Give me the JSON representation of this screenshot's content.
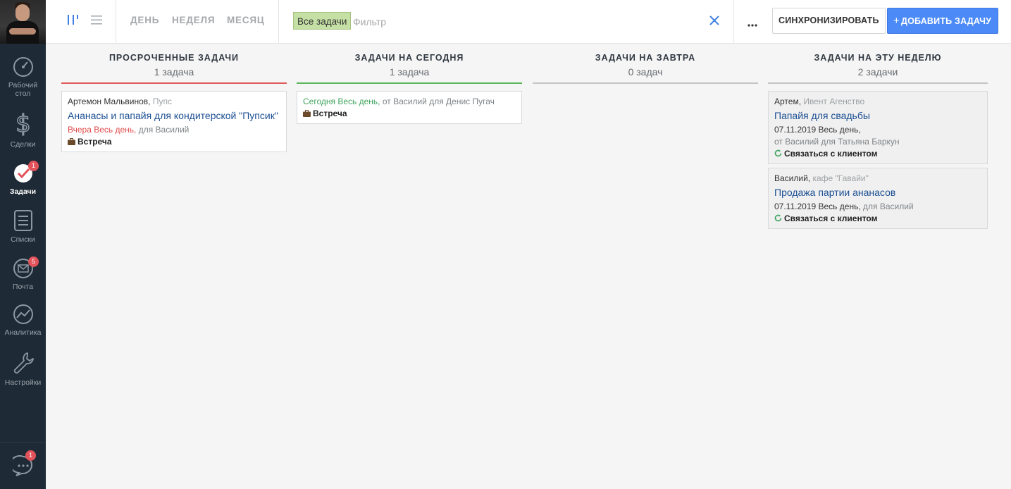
{
  "sidebar": {
    "items": [
      {
        "label": "Рабочий стол"
      },
      {
        "label": "Сделки"
      },
      {
        "label": "Задачи",
        "badge": "1"
      },
      {
        "label": "Списки"
      },
      {
        "label": "Почта",
        "badge": "5"
      },
      {
        "label": "Аналитика"
      },
      {
        "label": "Настройки"
      }
    ],
    "chat_badge": "1"
  },
  "topbar": {
    "periods": [
      "ДЕНЬ",
      "НЕДЕЛЯ",
      "МЕСЯЦ"
    ],
    "filter_chip": "Все задачи",
    "filter_placeholder": "Фильтр",
    "sync_label": "СИНХРОНИЗИРОВАТЬ",
    "add_label": "ДОБАВИТЬ ЗАДАЧУ",
    "add_plus": "+"
  },
  "colors": {
    "sidebar_bg": "#1e2a36",
    "accent_blue": "#4c8bf7",
    "overdue": "#e14a4a",
    "today": "#3fa45e",
    "neutral": "#c5c5c5"
  },
  "columns": [
    {
      "title": "ПРОСРОЧЕННЫЕ ЗАДАЧИ",
      "count": "1 задача",
      "line_color": "#e05b5b",
      "cards": [
        {
          "contact": "Артемон Мальвинов",
          "company": "Пупс",
          "title": "Ананасы и папайя для кондитерской \"Пупсик\"",
          "due": "Вчера Весь день,",
          "meta": "для Василий",
          "type": "Встреча"
        }
      ]
    },
    {
      "title": "ЗАДАЧИ НА СЕГОДНЯ",
      "count": "1 задача",
      "line_color": "#5cb85c",
      "cards": [
        {
          "due": "Сегодня Весь день,",
          "meta": "от Василий для Денис Пугач",
          "type": "Встреча"
        }
      ]
    },
    {
      "title": "ЗАДАЧИ НА ЗАВТРА",
      "count": "0 задач",
      "line_color": "#c5c5c5",
      "cards": []
    },
    {
      "title": "ЗАДАЧИ НА ЭТУ НЕДЕЛЮ",
      "count": "2 задачи",
      "line_color": "#c5c5c5",
      "cards": [
        {
          "contact": "Артем",
          "company": "Ивент Агенство",
          "title": "Папайя для свадьбы",
          "due": "07.11.2019 Весь день,",
          "meta": "от Василий для Татьяна Баркун",
          "type": "Связаться с клиентом"
        },
        {
          "contact": "Василий",
          "company": "кафе \"Гавайи\"",
          "title": "Продажа партии ананасов",
          "due": "07.11.2019 Весь день,",
          "meta": "для Василий",
          "type": "Связаться с клиентом"
        }
      ]
    }
  ]
}
